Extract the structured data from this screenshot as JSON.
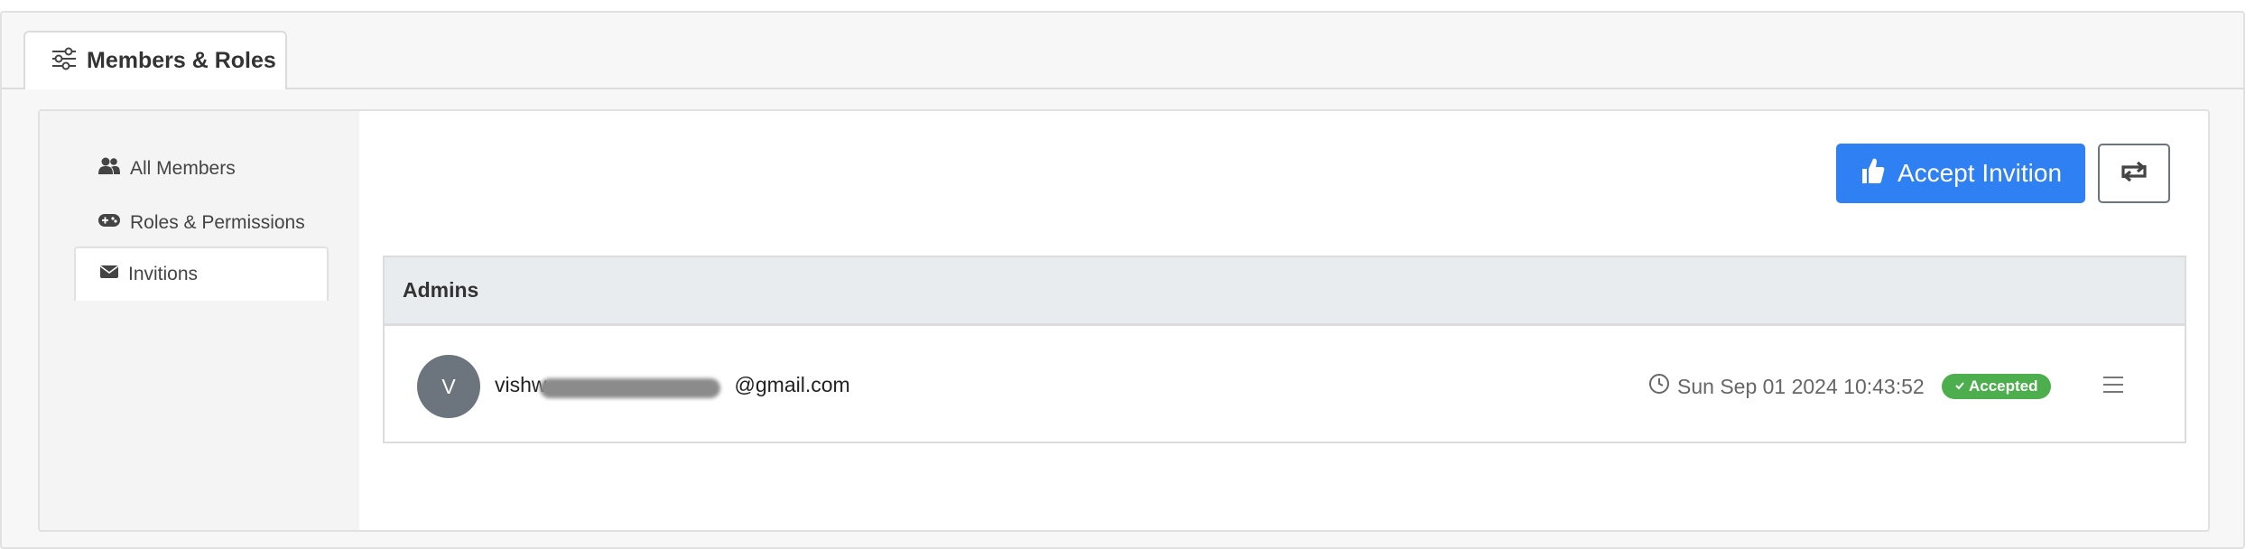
{
  "top_tab": {
    "label": "Members & Roles",
    "icon": "sliders-icon"
  },
  "sidebar": {
    "items": [
      {
        "label": "All Members",
        "icon": "users-icon",
        "active": false
      },
      {
        "label": "Roles & Permissions",
        "icon": "gamepad-icon",
        "active": false
      },
      {
        "label": "Invitions",
        "icon": "envelope-icon",
        "active": true
      }
    ]
  },
  "toolbar": {
    "accept_label": "Accept Invition",
    "accept_icon": "thumbs-up-icon",
    "refresh_icon": "refresh-icon"
  },
  "group": {
    "title": "Admins",
    "invitation": {
      "avatar_initial": "V",
      "email": "vishw",
      "email_end": "@gmail.com",
      "timestamp": "Sun Sep 01 2024 10:43:52",
      "status": "Accepted"
    }
  },
  "colors": {
    "primary": "#2f80f2",
    "success": "#4cae4c",
    "avatar": "#6c757d"
  }
}
